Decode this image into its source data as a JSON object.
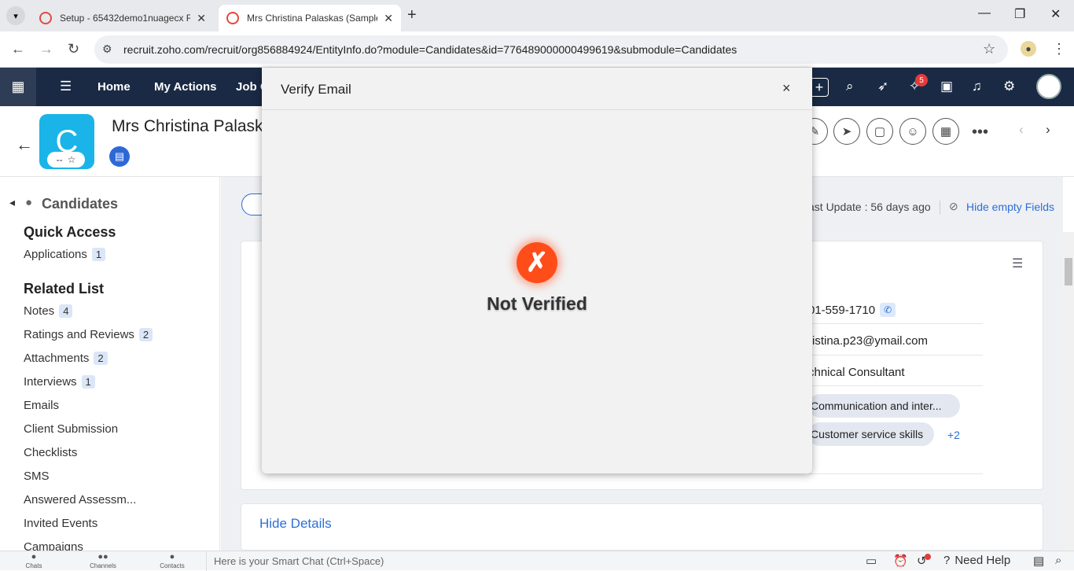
{
  "browser": {
    "tabs": [
      {
        "title": "Setup - 65432demo1nuagecx R",
        "close": "✕"
      },
      {
        "title": "Mrs Christina Palaskas (Sample)",
        "close": "✕"
      }
    ],
    "new_tab": "+",
    "url": "recruit.zoho.com/recruit/org856884924/EntityInfo.do?module=Candidates&id=776489000000499619&submodule=Candidates",
    "window_controls": {
      "minimize": "—",
      "maximize": "❐",
      "close": "✕"
    }
  },
  "appnav": {
    "links": [
      "Home",
      "My Actions",
      "Job O"
    ],
    "notification_count": "5"
  },
  "record": {
    "avatar_letter": "C",
    "rating": "--",
    "name": "Mrs Christina Palaska"
  },
  "sidebar": {
    "module": "Candidates",
    "quick_access_heading": "Quick Access",
    "quick_access": [
      {
        "label": "Applications",
        "count": "1"
      }
    ],
    "related_heading": "Related List",
    "related": [
      {
        "label": "Notes",
        "count": "4"
      },
      {
        "label": "Ratings and Reviews",
        "count": "2"
      },
      {
        "label": "Attachments",
        "count": "2"
      },
      {
        "label": "Interviews",
        "count": "1"
      },
      {
        "label": "Emails"
      },
      {
        "label": "Client Submission"
      },
      {
        "label": "Checklists"
      },
      {
        "label": "SMS"
      },
      {
        "label": "Answered Assessm..."
      },
      {
        "label": "Invited Events"
      },
      {
        "label": "Campaigns"
      }
    ]
  },
  "main": {
    "last_update": "ast Update : 56 days ago",
    "hide_empty": "Hide empty Fields",
    "fields": {
      "phone": "01-559-1710",
      "email": "ristina.p23@ymail.com",
      "title": "chnical Consultant"
    },
    "skills": [
      "Communication and inter...",
      "Customer service skills"
    ],
    "more_skills": "+2",
    "hide_details": "Hide Details"
  },
  "bottombar": {
    "tabs": [
      "Chats",
      "Channels",
      "Contacts"
    ],
    "smart_chat_placeholder": "Here is your Smart Chat (Ctrl+Space)",
    "need_help": "Need Help"
  },
  "modal": {
    "title": "Verify Email",
    "close": "×",
    "status_icon": "x-mark",
    "status_text": "Not Verified"
  },
  "colors": {
    "nav_bg": "#1a2a44",
    "accent_blue": "#2d6fd6",
    "status_red": "#ff4d1a"
  }
}
